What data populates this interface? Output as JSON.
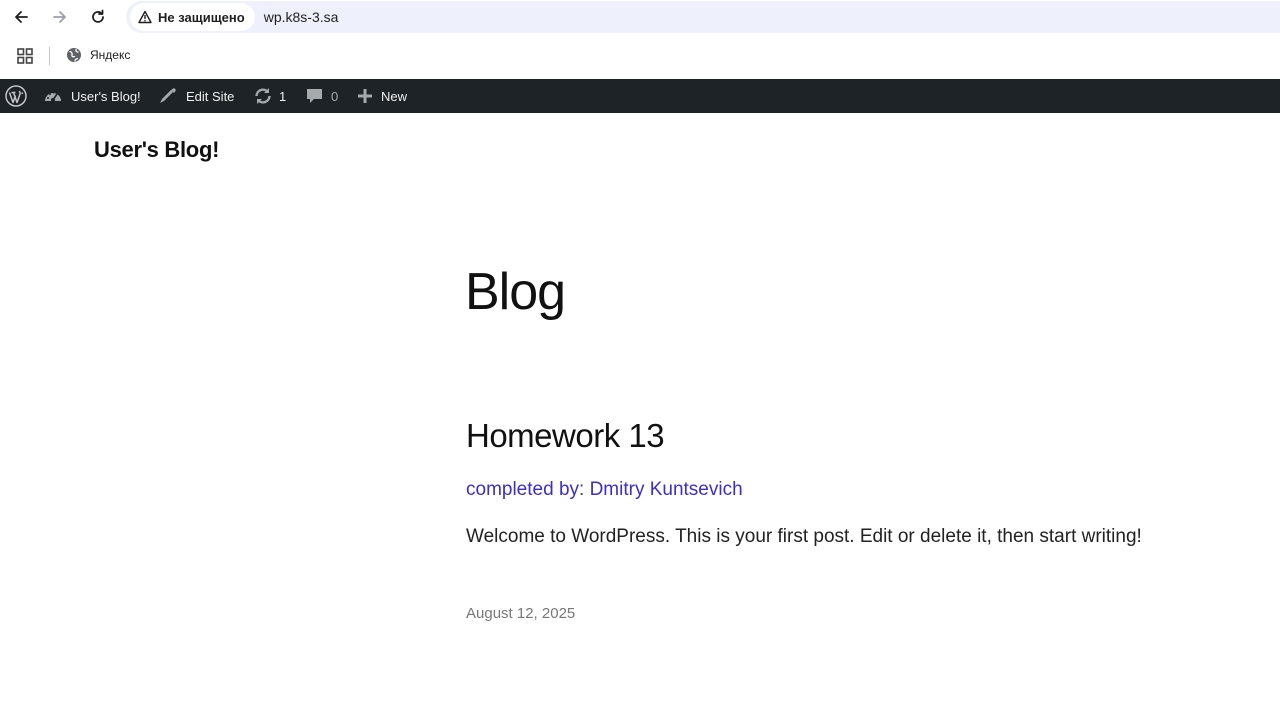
{
  "browser": {
    "security_label": "Не защищено",
    "url": "wp.k8s-3.sa",
    "bookmarks": [
      {
        "label": "Яндекс",
        "icon": "globe-icon"
      }
    ]
  },
  "adminbar": {
    "site_name": "User's Blog!",
    "edit_site": "Edit Site",
    "updates_count": "1",
    "comments_count": "0",
    "new_label": "New"
  },
  "site": {
    "title": "User's Blog!"
  },
  "page": {
    "heading": "Blog"
  },
  "post": {
    "title": "Homework 13",
    "subtitle": "completed by: Dmitry Kuntsevich",
    "excerpt": "Welcome to WordPress. This is your first post. Edit or delete it, then start writing!",
    "date": "August 12, 2025"
  },
  "colors": {
    "adminbar_bg": "#1d2327",
    "link": "#3b2fc9",
    "omnibox_bg": "#eef1fb"
  }
}
